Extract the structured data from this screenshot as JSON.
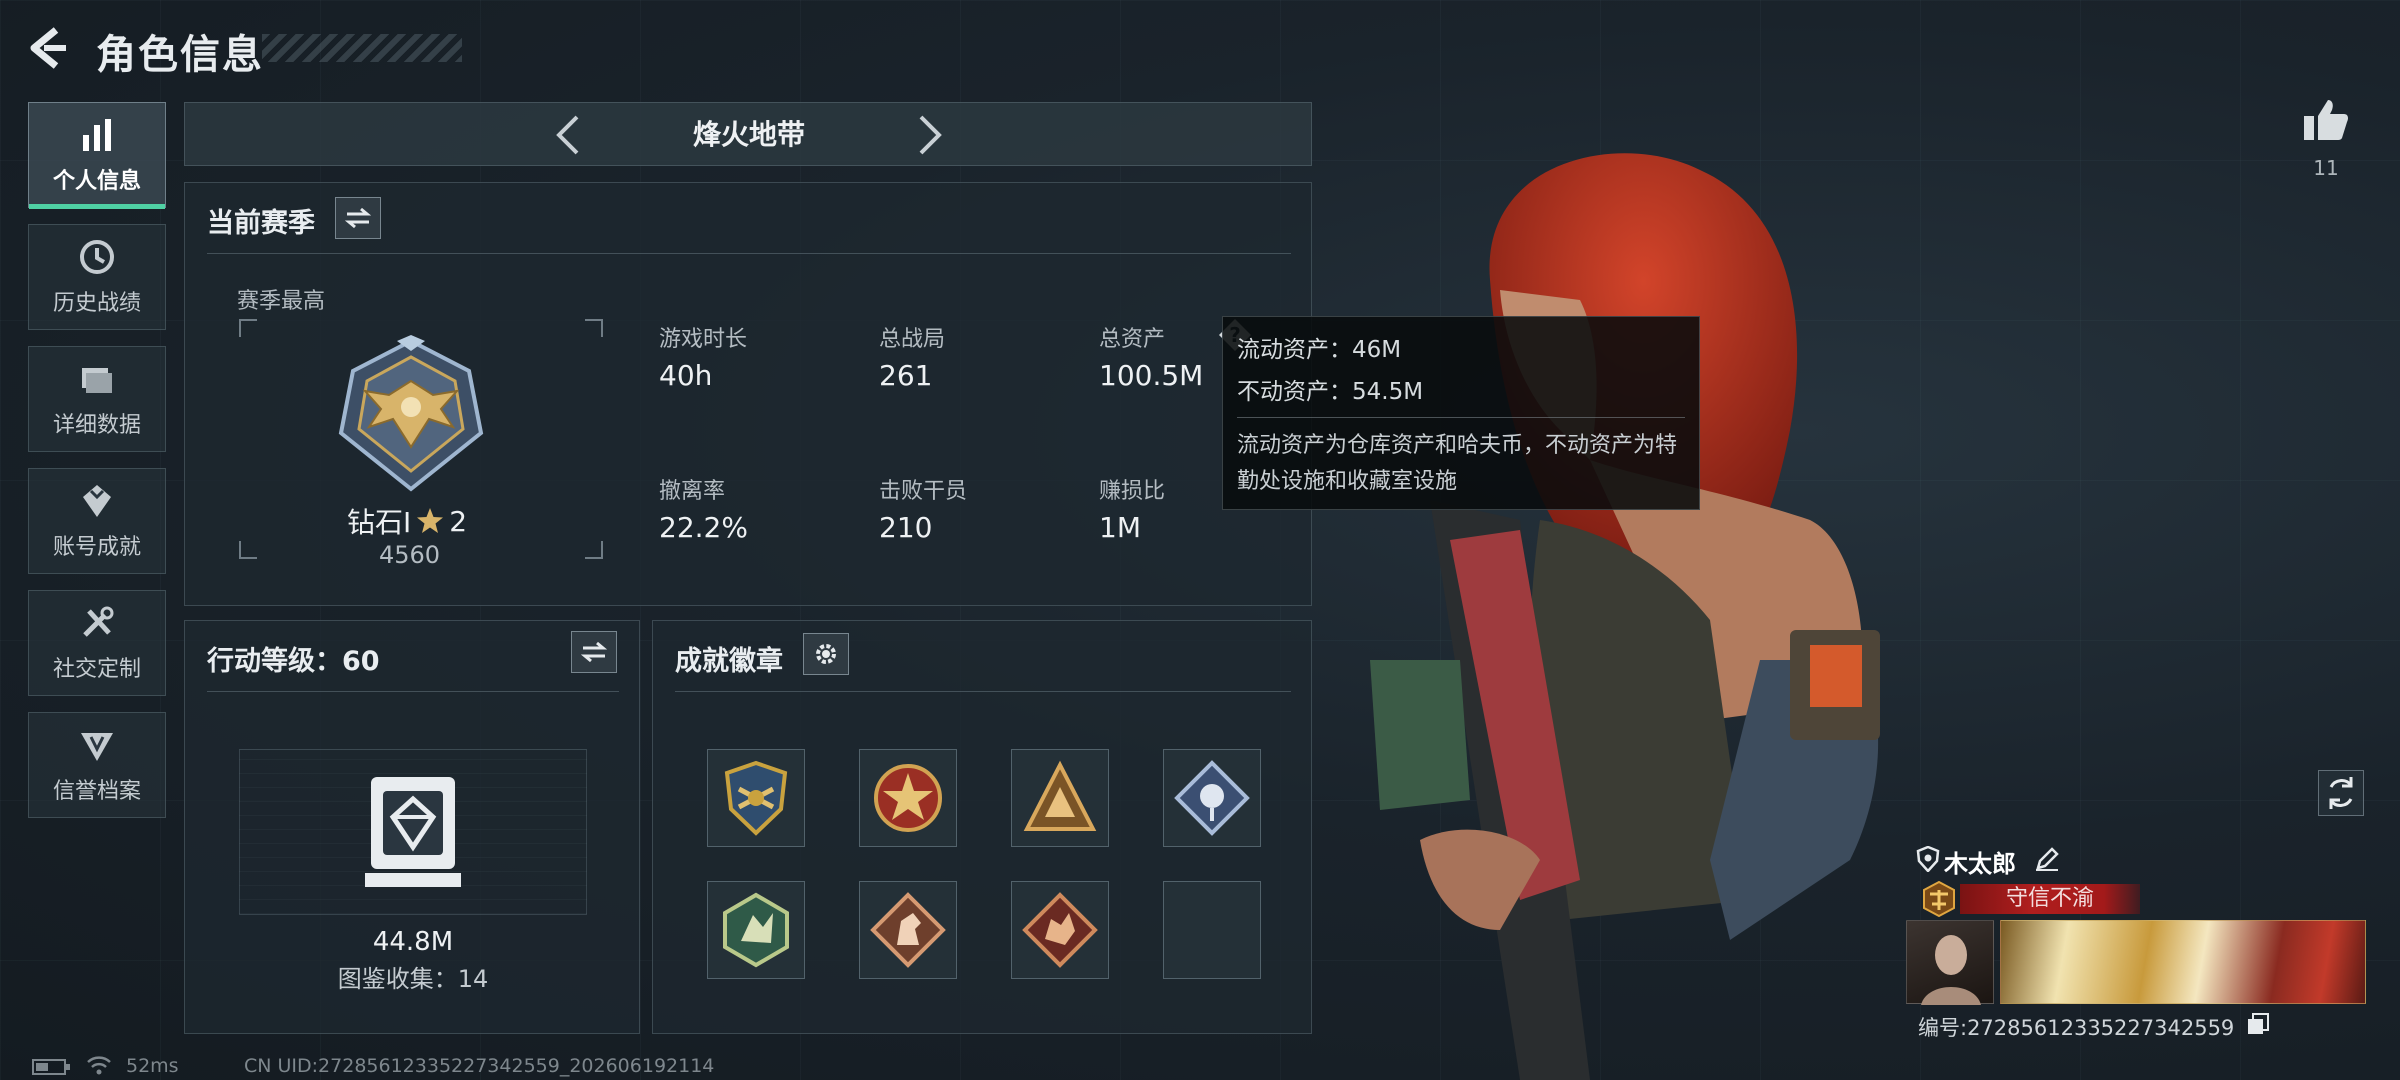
{
  "header": {
    "title": "角色信息"
  },
  "nav": [
    {
      "label": "个人信息",
      "icon": "bar-chart-icon",
      "active": true
    },
    {
      "label": "历史战绩",
      "icon": "clock-history-icon",
      "active": false
    },
    {
      "label": "详细数据",
      "icon": "folder-icon",
      "active": false
    },
    {
      "label": "账号成就",
      "icon": "achievement-icon",
      "active": false
    },
    {
      "label": "社交定制",
      "icon": "tools-icon",
      "active": false
    },
    {
      "label": "信誉档案",
      "icon": "credibility-icon",
      "active": false
    }
  ],
  "mode": {
    "title": "烽火地带"
  },
  "season": {
    "title": "当前赛季",
    "best_label": "赛季最高",
    "rank_name": "钻石Ⅰ",
    "rank_stars": "2",
    "rank_score": "4560",
    "stats": [
      {
        "label": "游戏时长",
        "value": "40h"
      },
      {
        "label": "总战局",
        "value": "261"
      },
      {
        "label": "总资产",
        "value": "100.5M"
      },
      {
        "label": "撤离率",
        "value": "22.2%"
      },
      {
        "label": "击败干员",
        "value": "210"
      },
      {
        "label": "赚损比",
        "value": "1M"
      }
    ]
  },
  "tooltip": {
    "liquid": "流动资产：46M",
    "fixed": "不动资产：54.5M",
    "desc": "流动资产为仓库资产和哈夫币，不动资产为特勤处设施和收藏室设施"
  },
  "action_level": {
    "title": "行动等级：60",
    "value": "44.8M",
    "collection": "图鉴收集：14"
  },
  "badges": {
    "title": "成就徽章",
    "items": [
      {
        "icon": "shield-badge-icon",
        "color": "#c9a23e"
      },
      {
        "icon": "star-emblem-badge-icon",
        "color": "#b7402f"
      },
      {
        "icon": "triangle-badge-icon",
        "color": "#b98a4a"
      },
      {
        "icon": "diamond-rose-badge-icon",
        "color": "#6c86b0"
      },
      {
        "icon": "hexagon-beast-badge-icon",
        "color": "#4f8a6a"
      },
      {
        "icon": "horse-diamond-badge-icon",
        "color": "#a36a4f"
      },
      {
        "icon": "dragon-diamond-badge-icon",
        "color": "#9e4a3a"
      },
      {
        "icon": "empty-slot",
        "color": ""
      }
    ]
  },
  "social": {
    "likes": "11"
  },
  "player": {
    "name": "木太郎",
    "reputation": "守信不渝",
    "id": "编号:27285612335227342559"
  },
  "footer": {
    "ping": "52ms",
    "uid": "CN UID:27285612335227342559_202606192114"
  },
  "colors": {
    "accent": "#4fd1a4",
    "tooltip_bg": "#080b0d",
    "rep_red": "#b01e1e"
  }
}
